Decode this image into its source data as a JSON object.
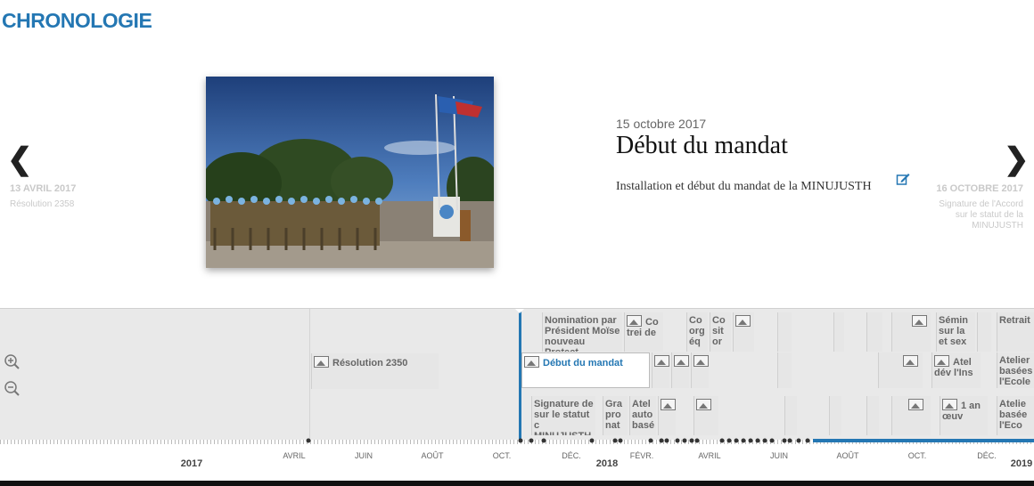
{
  "header": {
    "title": "CHRONOLOGIE"
  },
  "prev_slide": {
    "date": "13 AVRIL 2017",
    "headline": "Résolution 2358"
  },
  "next_slide": {
    "date": "16 OCTOBRE 2017",
    "headline": "Signature de l'Accord sur le statut de la MINUJUSTH"
  },
  "slide": {
    "date": "15 octobre 2017",
    "title": "Début du mandat",
    "text": "Installation et début du mandat de la MINUJUSTH"
  },
  "timenav": {
    "markers": [
      {
        "label": "Nomination par Président Moïse nouveau Protect",
        "row": 1
      },
      {
        "label": "Résolution 2350",
        "row": 2
      },
      {
        "label": "Début du mandat",
        "row": 2,
        "active": true
      },
      {
        "label": "Signature de sur le statut c MINUJUSTH",
        "row": 3
      },
      {
        "label": "Co trei de",
        "row": 1
      },
      {
        "label": "Co org éq",
        "row": 1
      },
      {
        "label": "Co sit or",
        "row": 1
      },
      {
        "label": "Sémin sur la et sex",
        "row": 1
      },
      {
        "label": "Retrait",
        "row": 1
      },
      {
        "label": "Atel dév l'Ins",
        "row": 2
      },
      {
        "label": "Atelier basées l'Ecole",
        "row": 2
      },
      {
        "label": "Gra pro nat",
        "row": 3
      },
      {
        "label": "Atel auto basé",
        "row": 3
      },
      {
        "label": "1 an œuv",
        "row": 3
      },
      {
        "label": "Atelie basée l'Eco",
        "row": 3
      }
    ],
    "months": [
      "AVRIL",
      "JUIN",
      "AOÛT",
      "OCT.",
      "DÉC.",
      "FÉVR.",
      "AVRIL",
      "JUIN",
      "AOÛT",
      "OCT.",
      "DÉC."
    ],
    "years": [
      "2017",
      "2018",
      "2019"
    ]
  },
  "colors": {
    "accent": "#2477b3",
    "text": "#111111",
    "muted": "#c9c9c9"
  },
  "icons": [
    "chevron-left-icon",
    "chevron-right-icon",
    "edit-icon",
    "zoom-in-icon",
    "zoom-out-icon",
    "image-icon"
  ]
}
